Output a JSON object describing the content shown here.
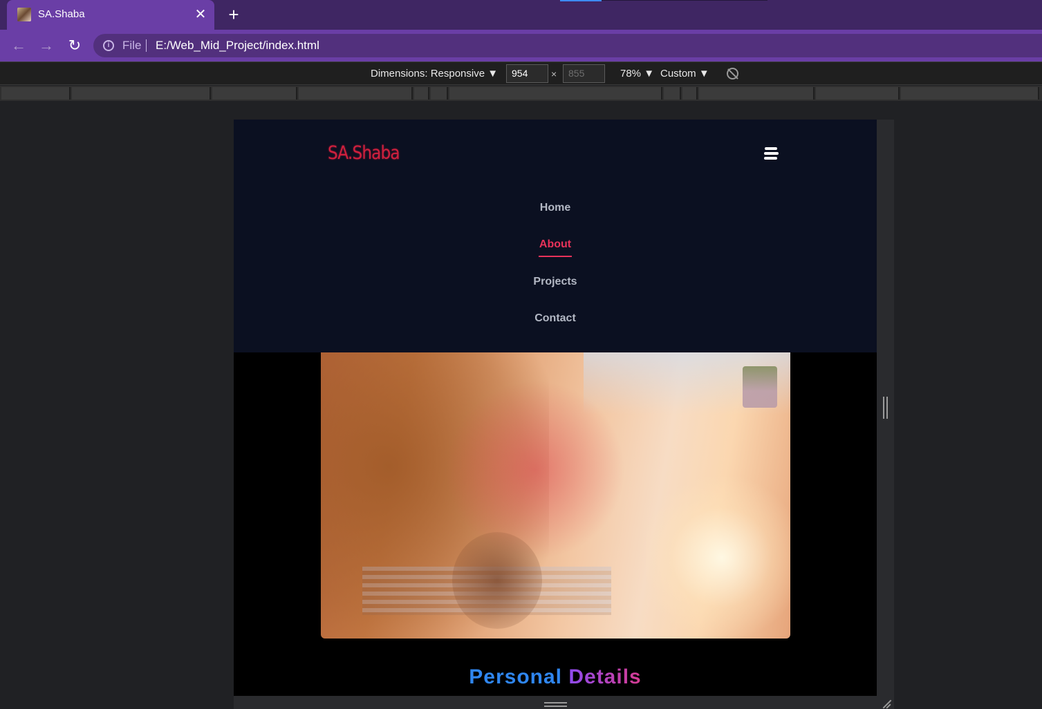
{
  "browser": {
    "tab": {
      "title": "SA.Shaba",
      "close_glyph": "✕"
    },
    "new_tab_glyph": "+",
    "toolbar": {
      "back_glyph": "←",
      "forward_glyph": "→",
      "reload_glyph": "↻",
      "info_glyph": "i",
      "scheme": "File",
      "url": "E:/Web_Mid_Project/index.html"
    }
  },
  "devtools": {
    "dimensions_label": "Dimensions: Responsive ▼",
    "width_value": "954",
    "height_placeholder": "855",
    "times_glyph": "×",
    "zoom": "78% ▼",
    "throttle": "Custom ▼",
    "rotate_icon": "rotate-icon"
  },
  "site": {
    "logo": "SA.Shaba",
    "nav": [
      {
        "label": "Home",
        "active": false
      },
      {
        "label": "About",
        "active": true
      },
      {
        "label": "Projects",
        "active": false
      },
      {
        "label": "Contact",
        "active": false
      }
    ],
    "section_title_part1": "Personal",
    "section_title_part2": "Details",
    "colors": {
      "header_bg": "#0b1021",
      "accent": "#e8325a",
      "logo": "#d0203e",
      "title_blue": "#2f86f0",
      "title_purple": "#b946d4"
    }
  }
}
